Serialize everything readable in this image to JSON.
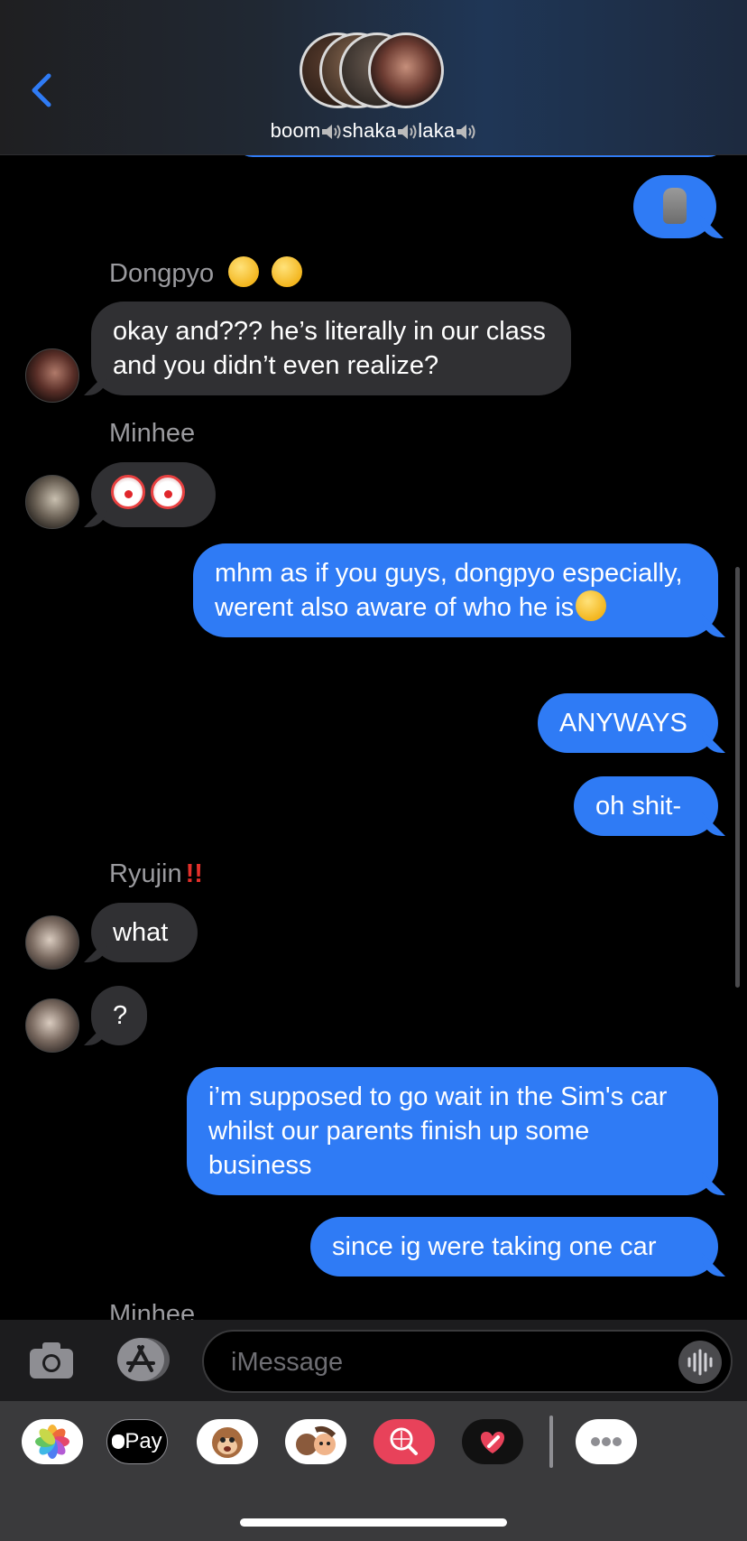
{
  "header": {
    "group_name_part1": "boom",
    "group_name_part2": "shaka",
    "group_name_part3": "laka",
    "avatar_count": 4
  },
  "messages": [
    {
      "id": "m0",
      "dir": "out",
      "content": "moai-emoji"
    },
    {
      "id": "m1",
      "sender": "Dongpyo",
      "sender_emoji": "yum-face-emoji yum-face-emoji",
      "dir": "in",
      "text": "okay and??? he’s literally in our class and you didn’t even realize?"
    },
    {
      "id": "m2",
      "sender": "Minhee",
      "dir": "in",
      "content": "clown-emoji clown-emoji"
    },
    {
      "id": "m3",
      "dir": "out",
      "text": "mhm as if you guys, dongpyo especially, werent also aware of who he is",
      "trailing_emoji": "neutral-face-emoji"
    },
    {
      "id": "m4",
      "dir": "out",
      "text": "ANYWAYS"
    },
    {
      "id": "m5",
      "dir": "out",
      "text": "oh shit-"
    },
    {
      "id": "m6",
      "sender": "Ryujin",
      "sender_emoji": "double-exclamation-emoji",
      "dir": "in",
      "text": "what"
    },
    {
      "id": "m7",
      "dir": "in",
      "text": "?"
    },
    {
      "id": "m8",
      "dir": "out",
      "text": "i’m supposed to go wait in the Sim's car whilst our parents finish up some business"
    },
    {
      "id": "m9",
      "dir": "out",
      "text": "since ig were taking one car"
    },
    {
      "id": "m10",
      "sender": "Minhee",
      "dir": "in",
      "text": ""
    }
  ],
  "input": {
    "placeholder": "iMessage"
  },
  "drawer": {
    "apps": [
      "photos-icon",
      "apple-pay",
      "animoji-icon",
      "memoji-icon",
      "search-images-icon",
      "digital-touch-icon",
      "more-icon"
    ],
    "apple_pay_label": "Pay"
  },
  "colors": {
    "outgoing": "#2f7bf5",
    "incoming": "#303033",
    "sender_label": "#9a9a9e",
    "back_chevron": "#2f7bf5"
  }
}
